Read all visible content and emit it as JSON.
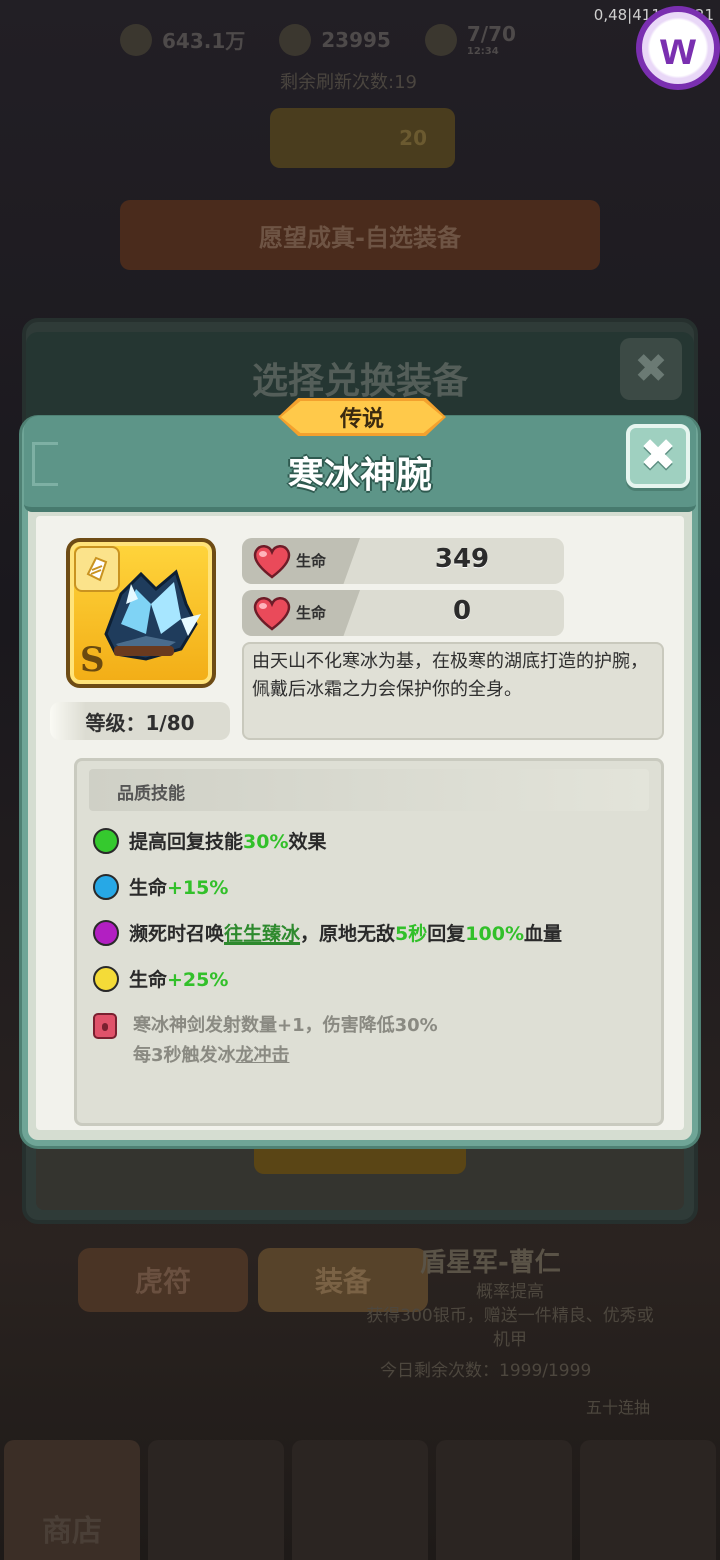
{
  "hud": {
    "version": "0,48|411815-21",
    "resources": [
      {
        "icon": "coin-icon",
        "value": "643.1万"
      },
      {
        "icon": "heart-currency-icon",
        "value": "23995"
      },
      {
        "icon": "stamina-icon",
        "value": "7/70",
        "timer": "12:34"
      }
    ],
    "refresh_text": "剩余刷新次数:19",
    "refresh_cost": "20",
    "wish_banner": "愿望成真-自选装备"
  },
  "background_panel": {
    "title": "选择兑换装备"
  },
  "background_shop": {
    "tabs": [
      "虎符",
      "装备"
    ],
    "hero_name": "盾星军-曹仁",
    "hero_desc_line1": "概率提高",
    "hero_desc_line2": "获得300银币，赠送一件精良、优秀或",
    "hero_desc_line3": "机甲",
    "remaining": "今日剩余次数：1999/1999",
    "fifty_draw": "五十连抽",
    "nav": [
      "商店"
    ]
  },
  "modal": {
    "rarity": "传说",
    "title": "寒冰神腕",
    "grade": "S",
    "level": "等级：1/80",
    "stats": [
      {
        "label": "生命",
        "value": "349"
      },
      {
        "label": "生命",
        "value": "0"
      }
    ],
    "description": "由天山不化寒冰为基，在极寒的湖底打造的护腕，佩戴后冰霜之力会保护你的全身。",
    "skills_title": "品质技能",
    "skills": {
      "s1": {
        "color": "#35c92e",
        "pre": "提高回复技能",
        "hi": "30%",
        "post": "效果"
      },
      "s2": {
        "color": "#27a8e6",
        "pre": "生命",
        "hi": "+15%"
      },
      "s3": {
        "color": "#b21fc2",
        "pre": "濒死时召唤",
        "link": "往生臻冰",
        "mid": "，原地无敌",
        "hi1": "5秒",
        "mid2": "回复",
        "hi2": "100%",
        "post": "血量"
      },
      "s4": {
        "color": "#f4db38",
        "pre": "生命",
        "hi": "+25%"
      }
    },
    "locked_line1": "寒冰神剑发射数量+1，伤害降低30%",
    "locked_line2_pre": "每3秒触发冰",
    "locked_line2_link": "龙冲击"
  }
}
